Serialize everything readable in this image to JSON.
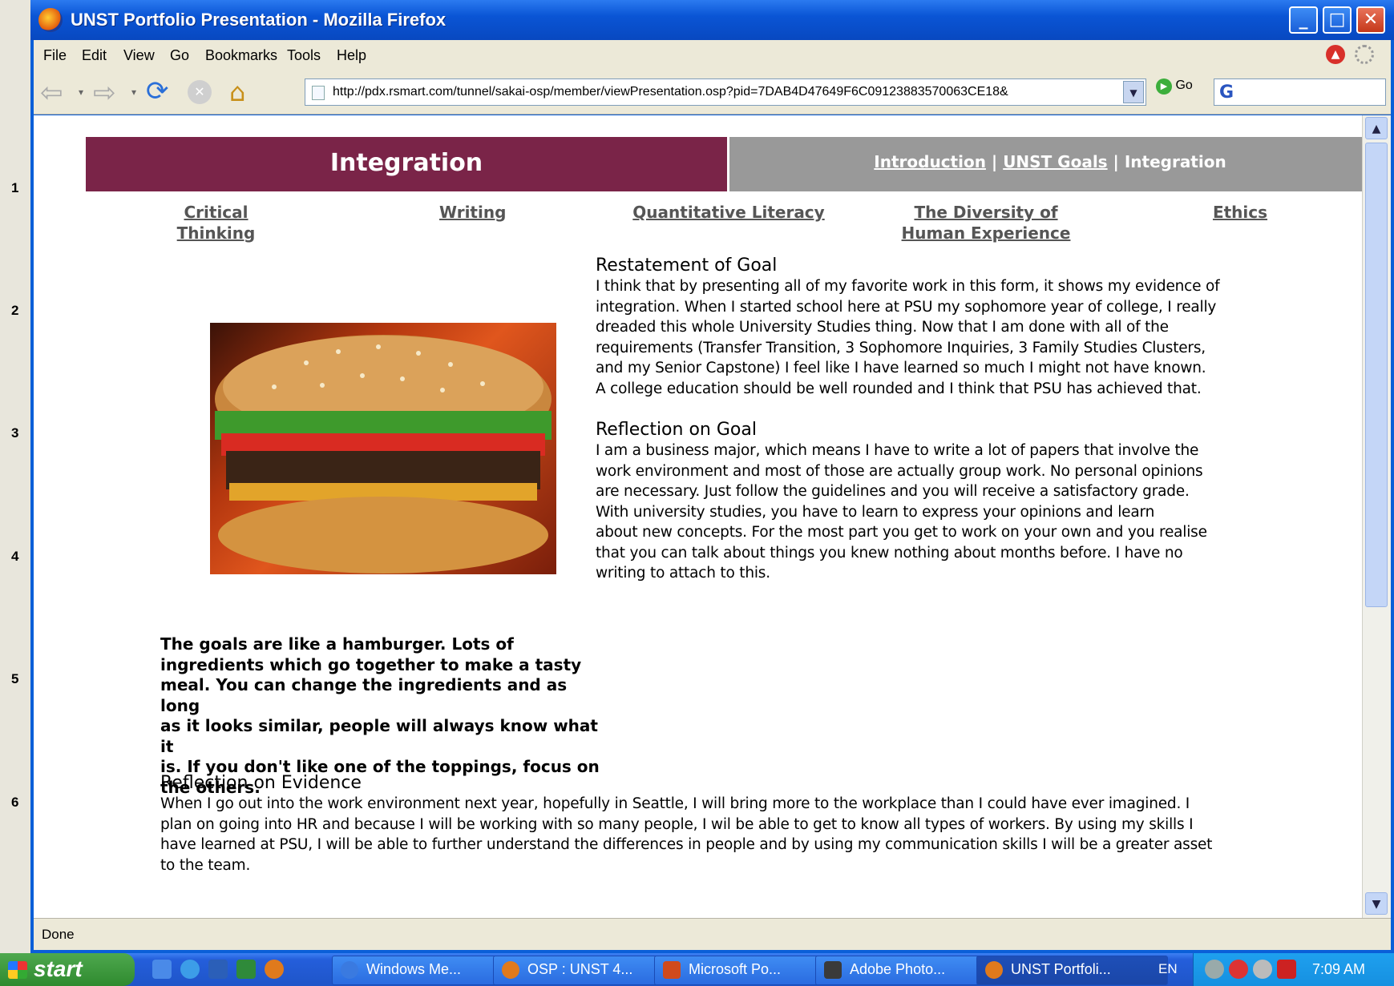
{
  "window": {
    "title": "UNST Portfolio Presentation - Mozilla Firefox"
  },
  "menu": [
    "File",
    "Edit",
    "View",
    "Go",
    "Bookmarks",
    "Tools",
    "Help"
  ],
  "address": {
    "url": "http://pdx.rsmart.com/tunnel/sakai-osp/member/viewPresentation.osp?pid=7DAB4D47649F6C09123883570063CE18&",
    "go_label": "Go"
  },
  "status": "Done",
  "ppt_numbers": [
    "1",
    "2",
    "3",
    "4",
    "5",
    "6"
  ],
  "page": {
    "banner_title": "Integration",
    "top_nav": {
      "intro": "Introduction",
      "sep1": " | ",
      "goals": "UNST Goals",
      "sep2": " | ",
      "current": "Integration"
    },
    "sub_nav": [
      "Critical Thinking",
      "Writing",
      "Quantitative Literacy",
      "The Diversity of Human Experience",
      "Ethics"
    ],
    "restatement": {
      "heading": "Restatement of Goal",
      "lines": [
        "I think that by presenting all of my favorite work in this form, it shows my evidence of",
        "integration.  When I started school here at PSU my sophomore year of college, I really",
        "dreaded this whole University Studies thing. Now that I am done with all of the",
        "requirements (Transfer Transition, 3 Sophomore Inquiries, 3 Family Studies Clusters,",
        "and my Senior Capstone) I feel like I have learned so much I might not have known.",
        "A college education should be well rounded and I think that PSU has achieved that."
      ]
    },
    "reflection_goal": {
      "heading": "Reflection on Goal",
      "lines": [
        "I am a business major, which means I have to write a lot of papers that involve the",
        "work environment and most of those are actually group work.  No personal opinions",
        "are necessary.  Just follow the guidelines and you will receive a satisfactory grade.",
        "With university studies, you have to learn to express your opinions and learn",
        "about new concepts.  For the most part you get to work on your own and you realise",
        "that you can talk about things you knew nothing about months before.  I have no",
        "writing to attach to this."
      ]
    },
    "caption_lines": [
      "The goals are like a hamburger. Lots of",
      "ingredients which go together to make a tasty",
      "meal. You can change the ingredients and as long",
      "as it looks similar, people will always know what it",
      "is. If you don't like one of the toppings, focus on",
      "the others."
    ],
    "reflection_evidence": {
      "heading": "Reflection on Evidence",
      "lines": [
        "When I go out into the work environment next year, hopefully in Seattle, I will bring more to the workplace than I could have ever imagined.  I",
        "plan on going into HR and because I will be working with so many people, I wil be able to get to know all types of workers.  By using my skills I",
        "have learned at PSU, I will be able to further understand the differences in people and by using my communication skills I will be a greater asset",
        "to the team."
      ]
    }
  },
  "taskbar": {
    "start": "start",
    "tasks": [
      "Windows Me...",
      "OSP : UNST 4...",
      "Microsoft Po...",
      "Adobe Photo...",
      "UNST Portfoli..."
    ],
    "lang": "EN",
    "clock": "7:09 AM"
  },
  "colors": {
    "banner": "#7a2448",
    "banner_right": "#999999"
  }
}
